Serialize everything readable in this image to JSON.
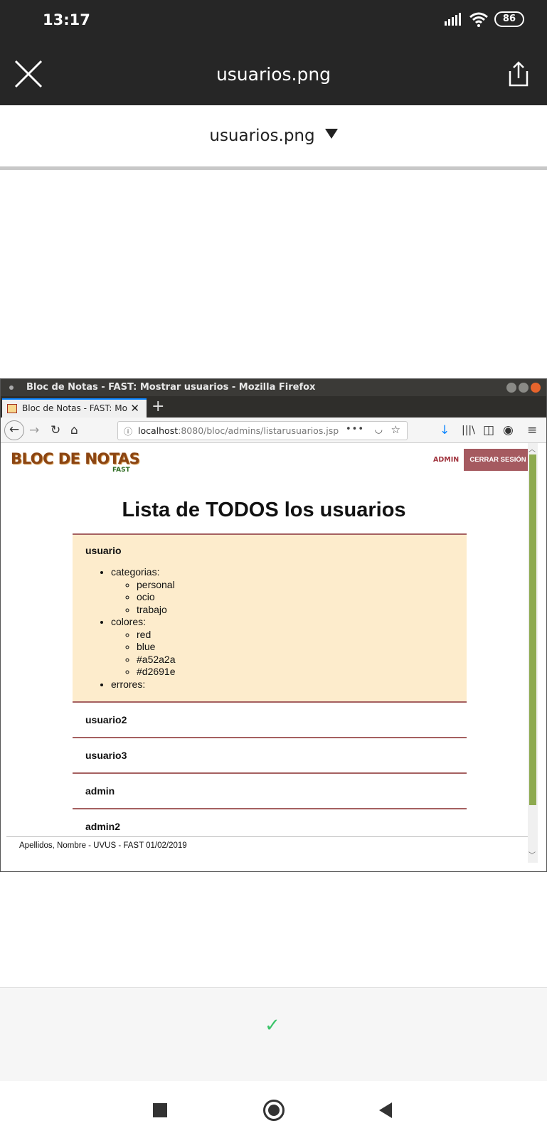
{
  "status_bar": {
    "time": "13:17",
    "battery": "86"
  },
  "viewer": {
    "title": "usuarios.png",
    "file_selector": "usuarios.png"
  },
  "browser": {
    "window_title": "Bloc de Notas - FAST: Mostrar usuarios - Mozilla Firefox",
    "tab_label": "Bloc de Notas - FAST: Mostrar usuarios",
    "url_host": "localhost",
    "url_rest": ":8080/bloc/admins/listarusuarios.jsp"
  },
  "site": {
    "logo": "BLOC DE NOTAS",
    "logo_sub": "FAST",
    "nav_admin": "ADMIN",
    "logout_label": "CERRAR SESIÓN",
    "heading": "Lista de TODOS los usuarios",
    "users": [
      {
        "name": "usuario",
        "details": {
          "categorias_label": "categorias:",
          "categorias": [
            "personal",
            "ocio",
            "trabajo"
          ],
          "colores_label": "colores:",
          "colores": [
            "red",
            "blue",
            "#a52a2a",
            "#d2691e"
          ],
          "errores_label": "errores:"
        }
      },
      {
        "name": "usuario2"
      },
      {
        "name": "usuario3"
      },
      {
        "name": "admin"
      },
      {
        "name": "admin2"
      }
    ],
    "footer": "Apellidos, Nombre - UVUS - FAST 01/02/2019"
  },
  "colors": {
    "accent": "#a55a60",
    "expanded_bg": "#fdeccc",
    "scroll_thumb": "#8daa4f",
    "confirm": "#3cc46a"
  }
}
